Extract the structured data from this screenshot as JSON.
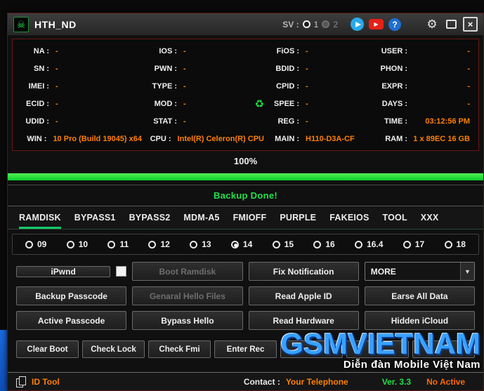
{
  "titlebar": {
    "title": "HTH_ND",
    "sv_label": "SV :",
    "sv_options": [
      {
        "label": "1",
        "selected": true
      },
      {
        "label": "2",
        "selected": false
      }
    ]
  },
  "info": {
    "fields": [
      {
        "label": "NA :",
        "value": "-"
      },
      {
        "label": "IOS :",
        "value": "-"
      },
      {
        "label": "FiOS :",
        "value": "-"
      },
      {
        "label": "USER :",
        "value": "-"
      },
      {
        "label": "SN :",
        "value": "-"
      },
      {
        "label": "PWN :",
        "value": "-"
      },
      {
        "label": "BDID :",
        "value": "-"
      },
      {
        "label": "PHON :",
        "value": "-"
      },
      {
        "label": "IMEI :",
        "value": "-"
      },
      {
        "label": "TYPE :",
        "value": "-"
      },
      {
        "label": "CPID :",
        "value": "-"
      },
      {
        "label": "EXPR :",
        "value": "-"
      },
      {
        "label": "ECID :",
        "value": "-"
      },
      {
        "label": "MOD :",
        "value": "-"
      },
      {
        "label": "SPEE :",
        "value": "-"
      },
      {
        "label": "DAYS :",
        "value": "-"
      },
      {
        "label": "UDID :",
        "value": "-"
      },
      {
        "label": "STAT :",
        "value": "-"
      },
      {
        "label": "REG :",
        "value": "-"
      },
      {
        "label": "TIME :",
        "value": "03:12:56 PM"
      },
      {
        "label": "WIN :",
        "value": "10 Pro (Build 19045) x64"
      },
      {
        "label": "CPU :",
        "value": "Intel(R) Celeron(R) CPU"
      },
      {
        "label": "MAIN :",
        "value": "H110-D3A-CF"
      },
      {
        "label": "RAM :",
        "value": "1 x 89EC 16 GB"
      }
    ]
  },
  "progress": {
    "percent_label": "100%",
    "percent": 100
  },
  "status": {
    "message": "Backup Done!"
  },
  "tabs": {
    "items": [
      {
        "label": "RAMDISK",
        "active": true
      },
      {
        "label": "BYPASS1",
        "active": false
      },
      {
        "label": "BYPASS2",
        "active": false
      },
      {
        "label": "MDM-A5",
        "active": false
      },
      {
        "label": "FMIOFF",
        "active": false
      },
      {
        "label": "PURPLE",
        "active": false
      },
      {
        "label": "FAKEIOS",
        "active": false
      },
      {
        "label": "TOOL",
        "active": false
      },
      {
        "label": "XXX",
        "active": false
      }
    ]
  },
  "ios": {
    "items": [
      {
        "label": "09",
        "selected": false
      },
      {
        "label": "10",
        "selected": false
      },
      {
        "label": "11",
        "selected": false
      },
      {
        "label": "12",
        "selected": false
      },
      {
        "label": "13",
        "selected": false
      },
      {
        "label": "14",
        "selected": true
      },
      {
        "label": "15",
        "selected": false
      },
      {
        "label": "16",
        "selected": false
      },
      {
        "label": "16.4",
        "selected": false
      },
      {
        "label": "17",
        "selected": false
      },
      {
        "label": "18",
        "selected": false
      }
    ]
  },
  "actions": {
    "ipwnd": "iPwnd",
    "boot_ramdisk": "Boot Ramdisk",
    "fix_notification": "Fix Notification",
    "more": "MORE",
    "backup_passcode": "Backup Passcode",
    "genaral_hello_files": "Genaral Hello Files",
    "read_apple_id": "Read Apple ID",
    "earse_all_data": "Earse All Data",
    "active_passcode": "Active Passcode",
    "bypass_hello": "Bypass Hello",
    "read_hardware": "Read Hardware",
    "hidden_icloud": "Hidden iCloud"
  },
  "bottom": {
    "items": [
      "Clear Boot",
      "Check Lock",
      "Check Fmi",
      "Enter Rec",
      "",
      "",
      ""
    ]
  },
  "watermark": {
    "title": "GSMVIETNAM",
    "subtitle": "Diễn đàn Mobile Việt Nam"
  },
  "footer": {
    "tool_label": "ID Tool",
    "contact_label": "Contact :",
    "contact_value": "Your Telephone",
    "version": "Ver. 3.3",
    "license_status": "No Active"
  },
  "colors": {
    "accent_green": "#1fe24b",
    "accent_orange": "#ff8000",
    "panel_border_red": "#6a1717",
    "watermark_blue": "#38a1ff",
    "youtube_red": "#e62117",
    "telegram_blue": "#29a9eb"
  }
}
